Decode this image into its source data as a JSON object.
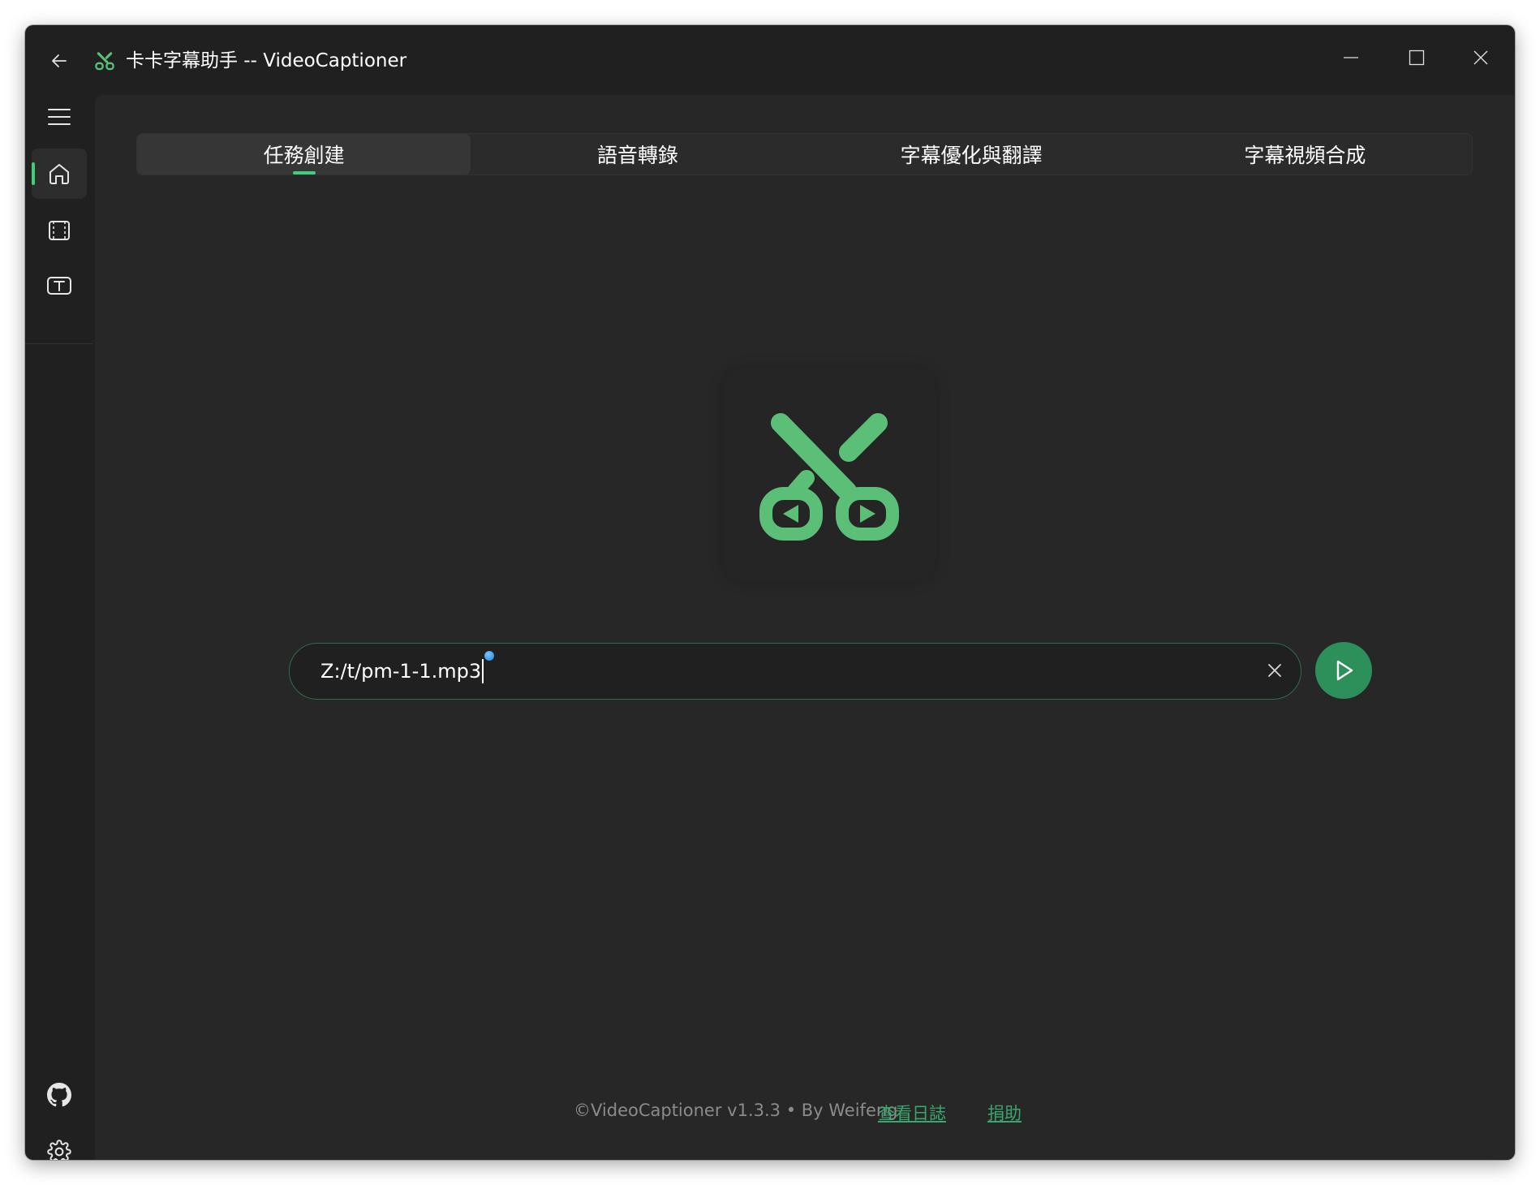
{
  "window": {
    "title": "卡卡字幕助手 -- VideoCaptioner",
    "controls": [
      "minimize",
      "maximize",
      "close"
    ]
  },
  "sidebar": {
    "items": [
      {
        "icon": "menu-icon",
        "active": false
      },
      {
        "icon": "home-icon",
        "active": true
      },
      {
        "icon": "video-icon",
        "active": false
      },
      {
        "icon": "text-icon",
        "active": false
      }
    ],
    "bottom_items": [
      {
        "icon": "github-icon"
      },
      {
        "icon": "gear-icon"
      }
    ]
  },
  "tabs": [
    {
      "label": "任務創建",
      "active": true
    },
    {
      "label": "語音轉錄",
      "active": false
    },
    {
      "label": "字幕優化與翻譯",
      "active": false
    },
    {
      "label": "字幕視頻合成",
      "active": false
    }
  ],
  "main": {
    "logo_icon": "scissors-play-icon",
    "path_input": {
      "value": "Z:/t/pm-1-1.mp3"
    },
    "run_button_icon": "play-icon"
  },
  "footer": {
    "copyright": "©VideoCaptioner v1.3.3 • By Weifeng",
    "log_link": "查看日誌",
    "donate_link": "捐助"
  },
  "colors": {
    "accent": "#3ecf7a",
    "logo_green": "#5bbf78",
    "run_button": "#2d8f5a",
    "link": "#3aa66c",
    "background": "#272727",
    "chrome": "#202020"
  }
}
